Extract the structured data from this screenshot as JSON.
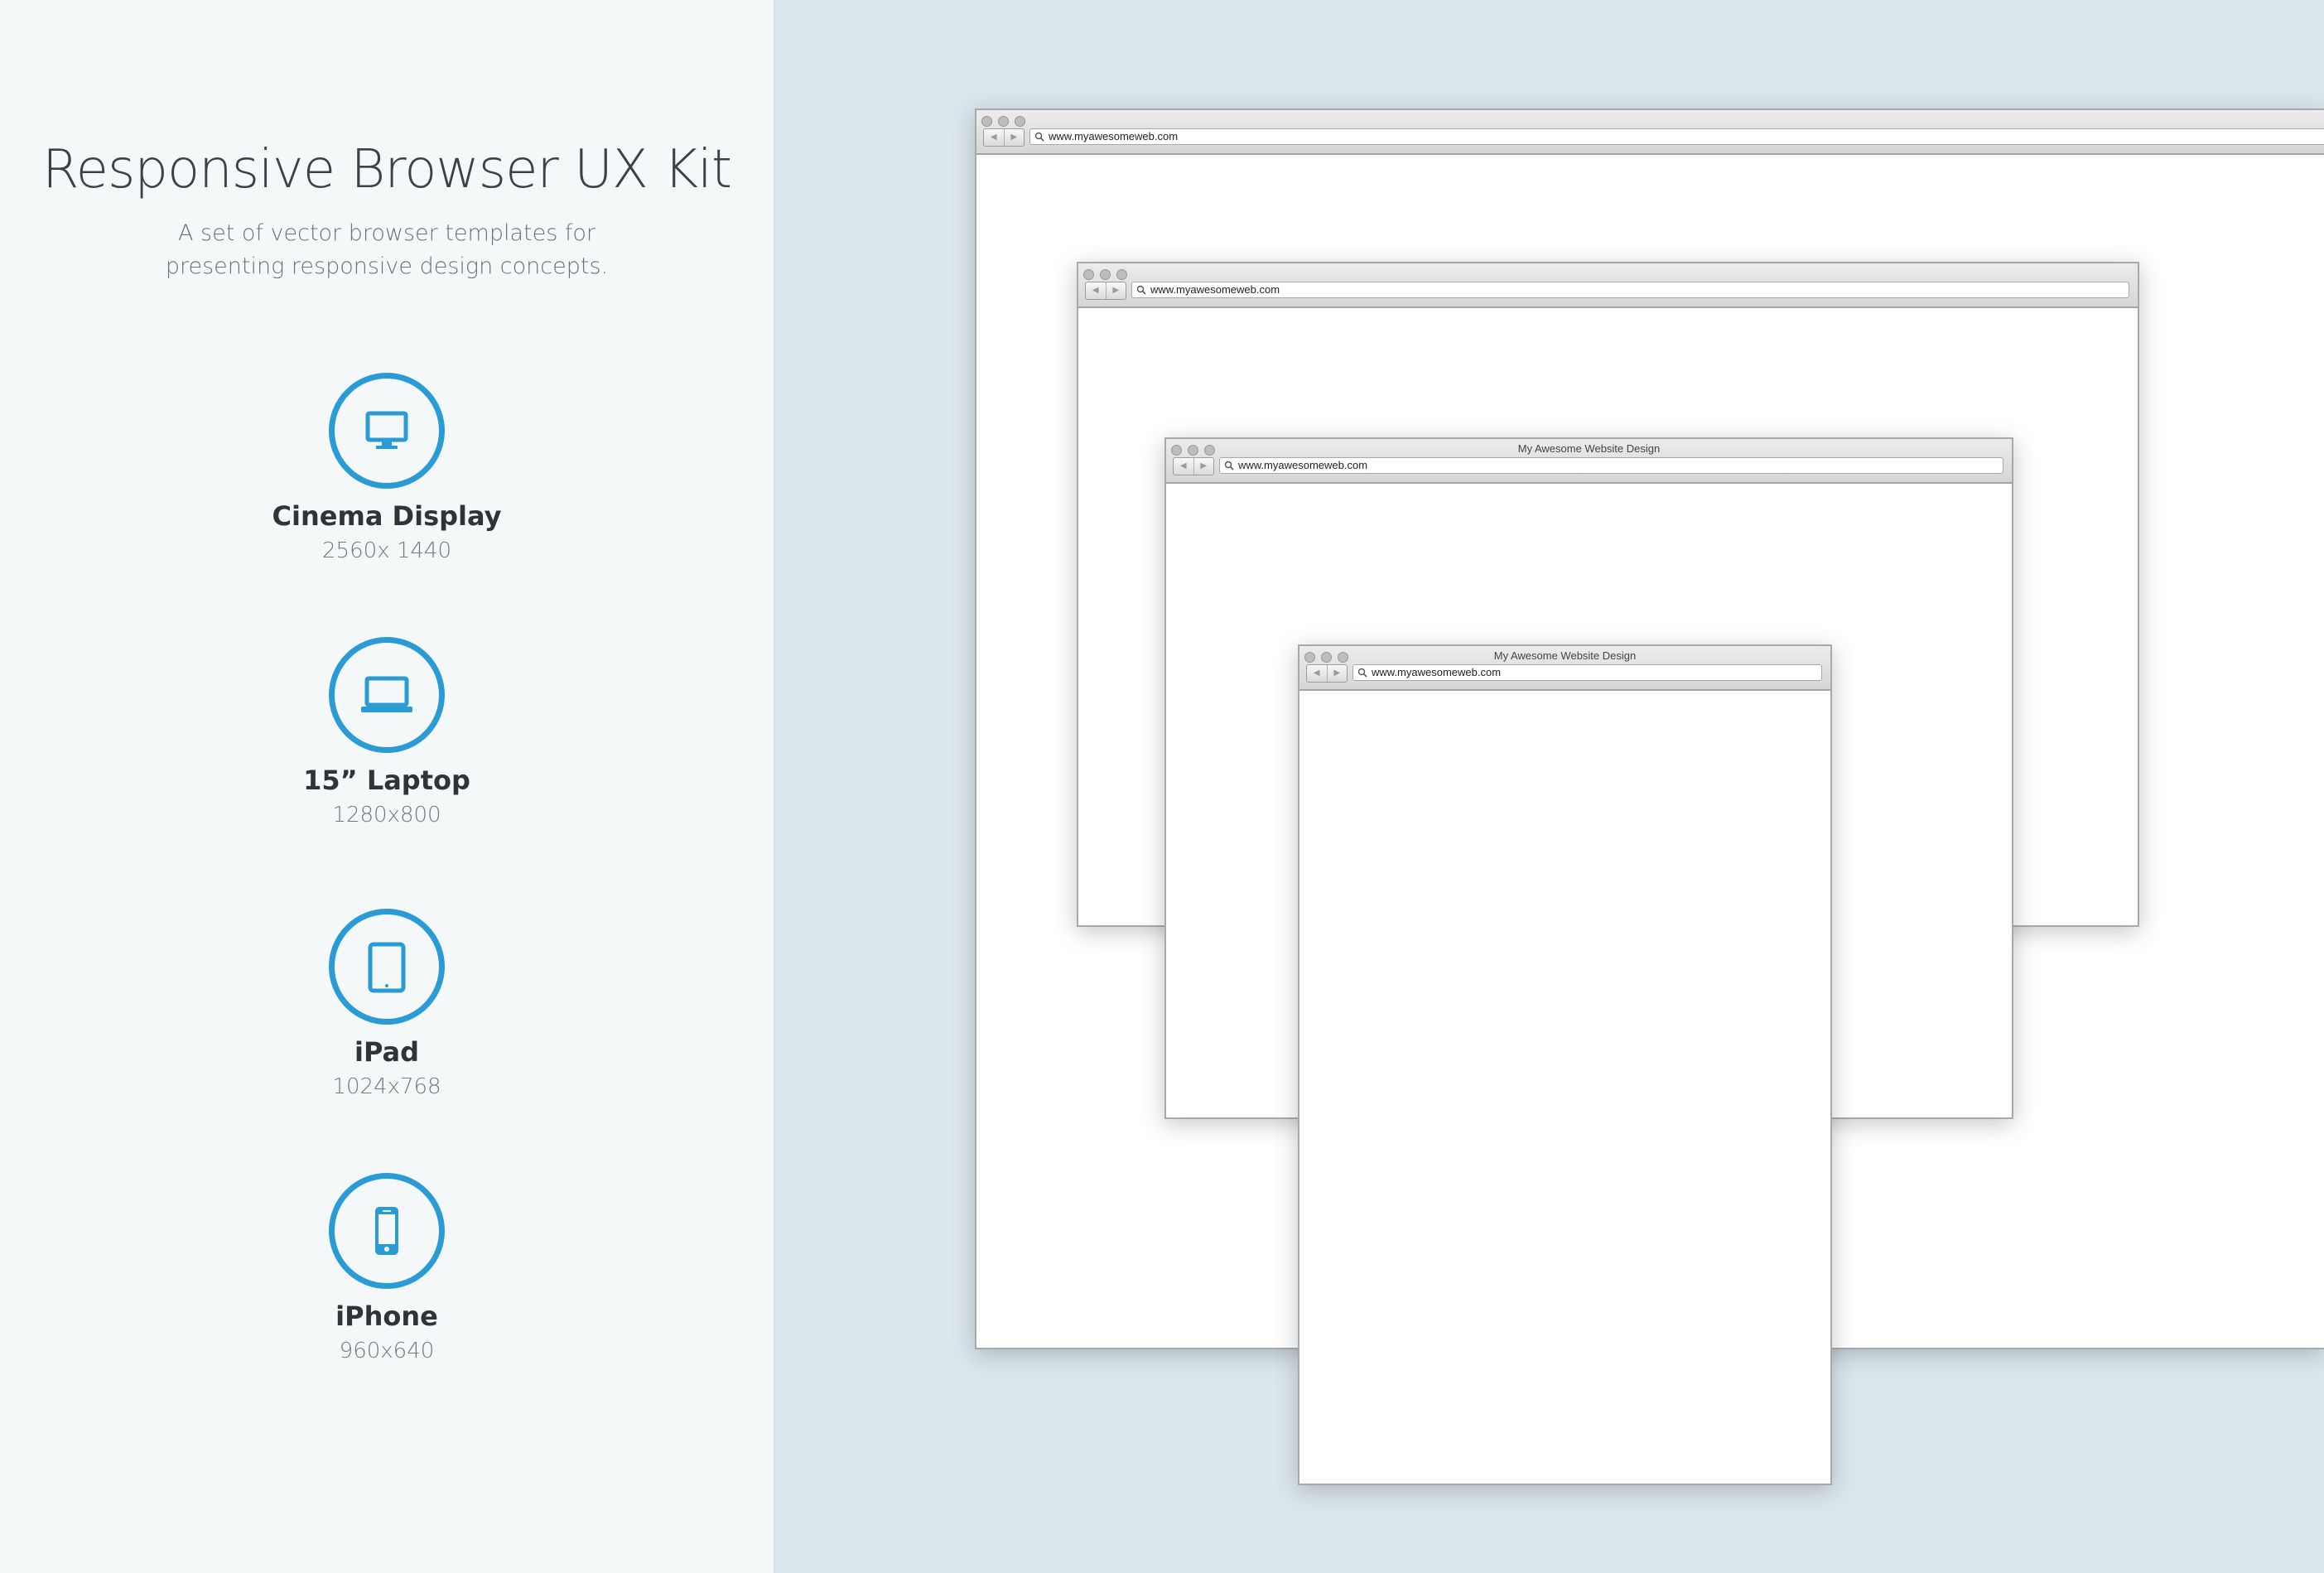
{
  "kit": {
    "title": "Responsive Browser UX Kit",
    "subtitle": "A set of vector browser templates for presenting responsive design concepts."
  },
  "devices": [
    {
      "name": "Cinema Display",
      "resolution": "2560x 1440",
      "icon": "monitor-icon"
    },
    {
      "name": "15” Laptop",
      "resolution": "1280x800",
      "icon": "laptop-icon"
    },
    {
      "name": "iPad",
      "resolution": "1024x768",
      "icon": "tablet-icon"
    },
    {
      "name": "iPhone",
      "resolution": "960x640",
      "icon": "phone-icon"
    }
  ],
  "browsers": [
    {
      "title": "",
      "url": "www.myawesomeweb.com"
    },
    {
      "title": "",
      "url": "www.myawesomeweb.com"
    },
    {
      "title": "My Awesome Website Design",
      "url": "www.myawesomeweb.com"
    },
    {
      "title": "My Awesome Website Design",
      "url": "www.myawesomeweb.com"
    }
  ],
  "nav": {
    "back": "◀",
    "forward": "▶"
  },
  "colors": {
    "accent": "#2b9bd6",
    "left_bg": "#f4f8f9",
    "right_bg": "#dce6ed"
  }
}
